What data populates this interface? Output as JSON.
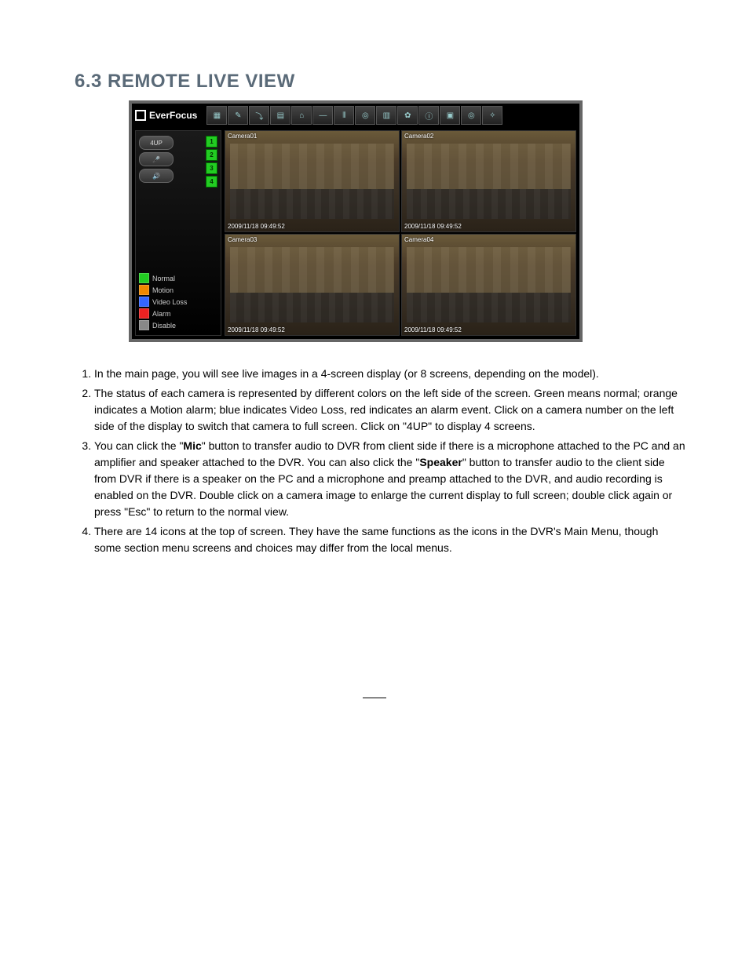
{
  "heading": "6.3  REMOTE LIVE VIEW",
  "dvr": {
    "brand": "EverFocus",
    "top_icons": [
      "▦",
      "✎",
      "⤵",
      "▤",
      "⌂",
      "—",
      "⫴",
      "◎",
      "▥",
      "✿",
      "ⓘ",
      "▣",
      "◎",
      "✧"
    ],
    "sidebar": {
      "btn_4up": "4UP",
      "btn_mic": "🎤",
      "btn_speaker": "🔊",
      "camera_numbers": [
        "1",
        "2",
        "3",
        "4"
      ],
      "legend": [
        {
          "color": "#2c2",
          "label": "Normal"
        },
        {
          "color": "#e80",
          "label": "Motion"
        },
        {
          "color": "#36f",
          "label": "Video Loss"
        },
        {
          "color": "#e22",
          "label": "Alarm"
        },
        {
          "color": "#888",
          "label": "Disable"
        }
      ]
    },
    "cameras": [
      {
        "name": "Camera01",
        "timestamp": "2009/11/18 09:49:52"
      },
      {
        "name": "Camera02",
        "timestamp": "2009/11/18 09:49:52"
      },
      {
        "name": "Camera03",
        "timestamp": "2009/11/18 09:49:52"
      },
      {
        "name": "Camera04",
        "timestamp": "2009/11/18 09:49:52"
      }
    ]
  },
  "list": {
    "i1": "In the main page, you will see live images in a 4-screen display (or 8 screens, depending on the model).",
    "i2": "The status of each camera is represented by different colors on the left side of the screen. Green means normal; orange indicates a Motion alarm; blue indicates Video Loss, red indicates an alarm event. Click on a camera number on the left side of the display to switch that camera to full screen. Click on \"4UP\" to display 4 screens.",
    "i3a": "You can click the \"",
    "i3_mic": "Mic",
    "i3b": "\" button to transfer audio to DVR from client side if there is a microphone attached to the PC and an amplifier and speaker attached to the DVR. You can also click the \"",
    "i3_spk": "Speaker",
    "i3c": "\" button to transfer audio to the client side from DVR if there is a speaker on the PC and a microphone and preamp attached to the DVR, and audio recording is enabled on the DVR. Double click on a camera image to enlarge the current display to full screen; double click again or press \"Esc\" to return to the normal view.",
    "i4": "There are 14 icons at the top of screen. They have the same functions as the icons in the DVR's Main Menu, though some section menu screens and choices may differ from the local menus."
  }
}
